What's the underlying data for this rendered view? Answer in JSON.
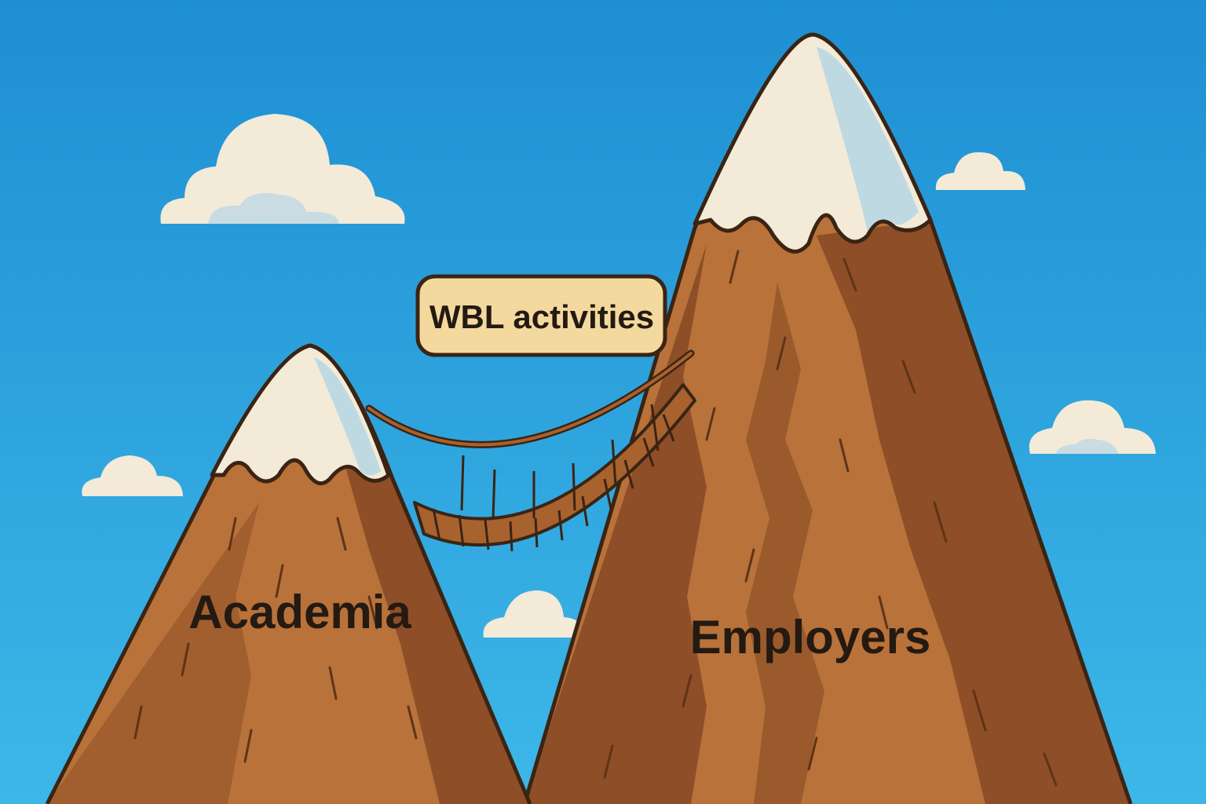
{
  "labels": {
    "bridge": "WBL activities",
    "left_peak": "Academia",
    "right_peak": "Employers"
  },
  "colors": {
    "sky_top": "#1E8FD3",
    "sky_bottom": "#3DB7E8",
    "rock": "#B8723A",
    "rock_shadow": "#8E4E27",
    "rock_light": "#D08A45",
    "outline": "#3A2414",
    "snow": "#F3EAD8",
    "snow_shadow": "#BFD9E2",
    "cloud": "#F3EAD8",
    "cloud_shadow": "#C8DCE2",
    "bridge_wood": "#A8622E",
    "label_box": "#F3D99E"
  }
}
